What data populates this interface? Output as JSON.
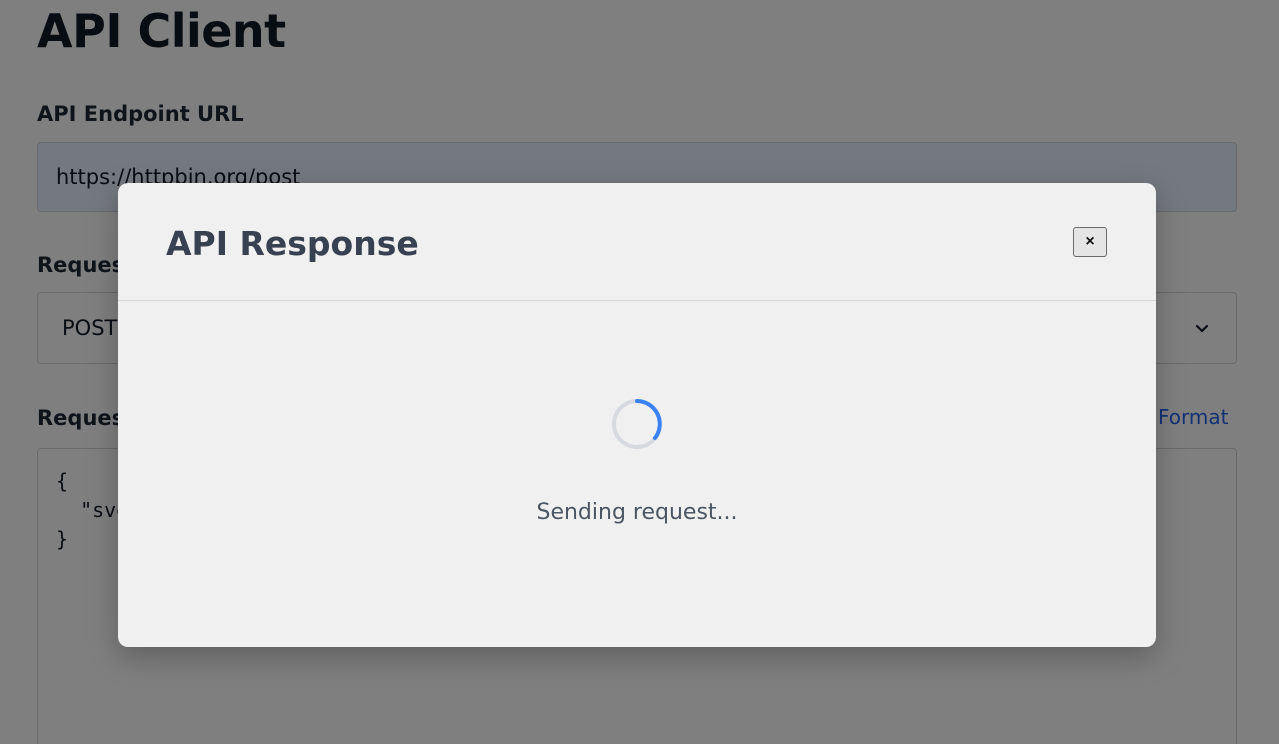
{
  "page": {
    "title": "API Client",
    "url_label": "API Endpoint URL",
    "url_value": "https://httpbin.org/post",
    "method_label": "Request Method",
    "method_value": "POST",
    "body_label": "Request Body (JSON)",
    "format_label": "Format",
    "body_value": "{\n  \"svelte\": \"awesome\"\n}"
  },
  "modal": {
    "title": "API Response",
    "close_label": "×",
    "loading_text": "Sending request..."
  },
  "colors": {
    "accent": "#2563eb",
    "spinner": "#3b82f6",
    "overlay": "rgba(0,0,0,0.5)"
  },
  "icons": {
    "select_chevron": "chevron-down-icon",
    "spinner": "loading-spinner-icon"
  }
}
